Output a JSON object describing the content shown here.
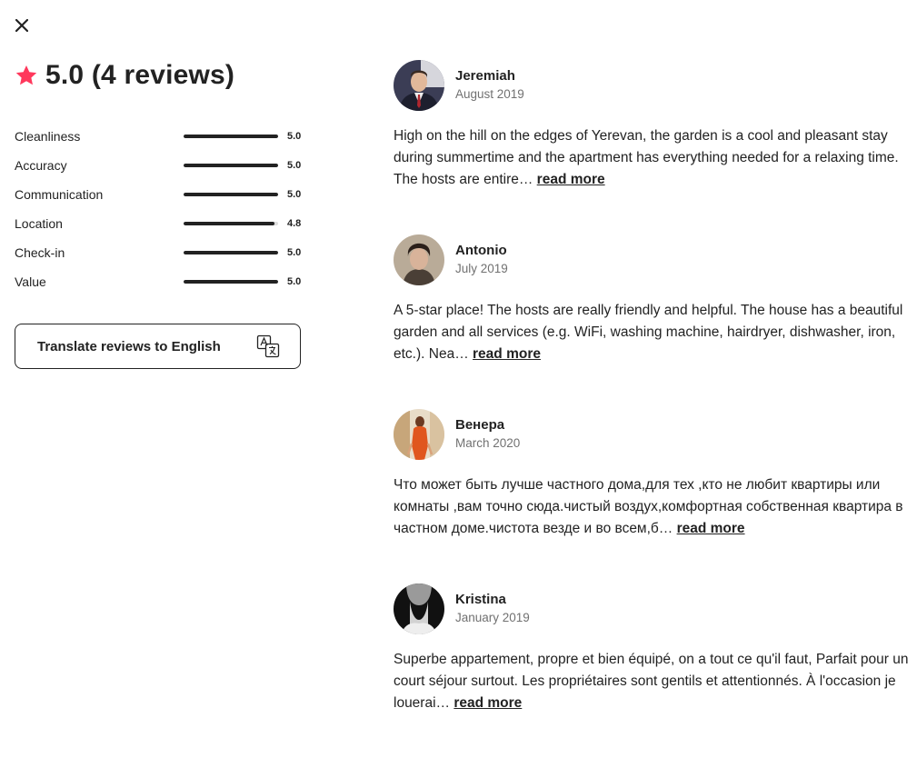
{
  "header": {
    "close_icon": "close-icon",
    "star_icon": "star-icon",
    "star_color": "#FF385C",
    "title": "5.0 (4 reviews)"
  },
  "ratings": [
    {
      "label": "Cleanliness",
      "value": "5.0",
      "score": 5.0
    },
    {
      "label": "Accuracy",
      "value": "5.0",
      "score": 5.0
    },
    {
      "label": "Communication",
      "value": "5.0",
      "score": 5.0
    },
    {
      "label": "Location",
      "value": "4.8",
      "score": 4.8
    },
    {
      "label": "Check-in",
      "value": "5.0",
      "score": 5.0
    },
    {
      "label": "Value",
      "value": "5.0",
      "score": 5.0
    }
  ],
  "rating_max": 5,
  "translate": {
    "label": "Translate reviews to English",
    "icon": "translate-icon"
  },
  "reviews": [
    {
      "name": "Jeremiah",
      "date": "August 2019",
      "text": "High on the hill on the edges of Yerevan, the garden is a cool and pleasant stay during summertime and the apartment has everything needed for a relaxing time. The hosts are entire…",
      "read_more": "read more"
    },
    {
      "name": "Antonio",
      "date": "July 2019",
      "text": "A 5-star place! The hosts are really friendly and helpful. The house has a beautiful garden and all services (e.g. WiFi, washing machine, hairdryer, dishwasher, iron, etc.). Nea…",
      "read_more": "read more"
    },
    {
      "name": "Венера",
      "date": "March 2020",
      "text": "Что может быть лучше частного дома,для тех ,кто не любит квартиры или комнаты ,вам точно сюда.чистый воздух,комфортная собственная квартира в частном доме.чистота везде и во всем,б…",
      "read_more": "read more"
    },
    {
      "name": "Kristina",
      "date": "January 2019",
      "text": "Superbe appartement, propre et bien équipé, on a tout ce qu'il faut, Parfait pour un court séjour surtout. Les propriétaires sont gentils et attentionnés. À l'occasion je louerai…",
      "read_more": "read more"
    }
  ]
}
